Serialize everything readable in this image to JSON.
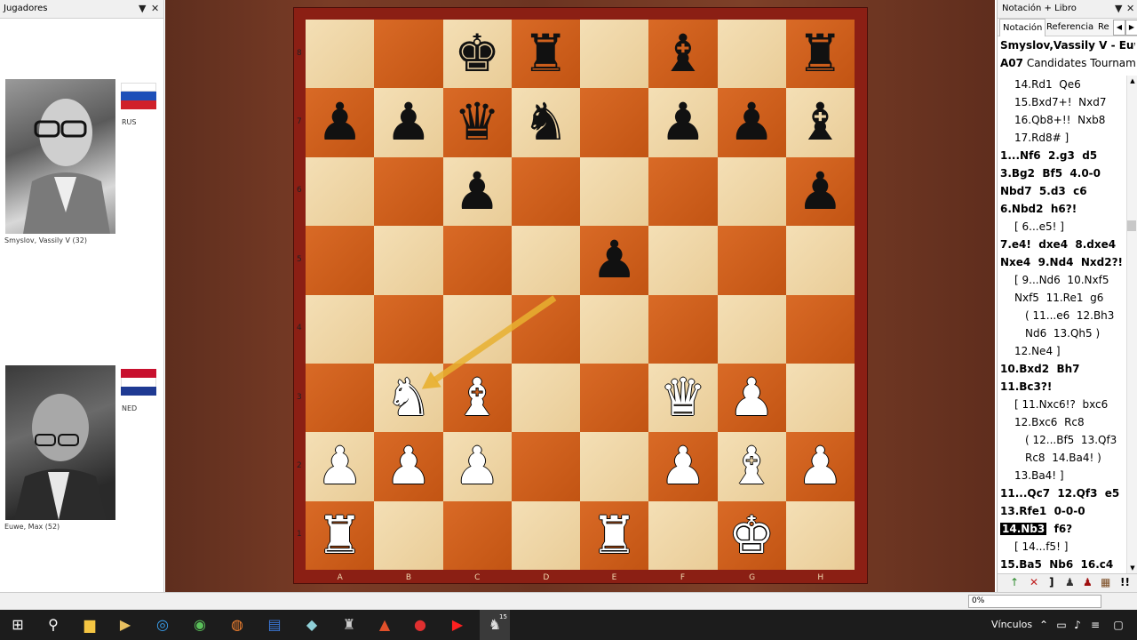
{
  "left_panel": {
    "title": "Jugadores",
    "players": [
      {
        "name": "Smyslov, Vassily V  (32)",
        "country": "RUS",
        "flag_colors": [
          "#ffffff",
          "#1d4fb8",
          "#d0202a"
        ]
      },
      {
        "name": "Euwe, Max  (52)",
        "country": "NED",
        "flag_colors": [
          "#c8102e",
          "#ffffff",
          "#1f3a93"
        ]
      }
    ]
  },
  "board": {
    "files": [
      "A",
      "B",
      "C",
      "D",
      "E",
      "F",
      "G",
      "H"
    ],
    "ranks": [
      "8",
      "7",
      "6",
      "5",
      "4",
      "3",
      "2",
      "1"
    ],
    "pieces": [
      {
        "sq": "c8",
        "glyph": "♚",
        "color": "black"
      },
      {
        "sq": "d8",
        "glyph": "♜",
        "color": "black"
      },
      {
        "sq": "f8",
        "glyph": "♝",
        "color": "black"
      },
      {
        "sq": "h8",
        "glyph": "♜",
        "color": "black"
      },
      {
        "sq": "a7",
        "glyph": "♟",
        "color": "black"
      },
      {
        "sq": "b7",
        "glyph": "♟",
        "color": "black"
      },
      {
        "sq": "c7",
        "glyph": "♛",
        "color": "black"
      },
      {
        "sq": "d7",
        "glyph": "♞",
        "color": "black"
      },
      {
        "sq": "f7",
        "glyph": "♟",
        "color": "black"
      },
      {
        "sq": "g7",
        "glyph": "♟",
        "color": "black"
      },
      {
        "sq": "h7",
        "glyph": "♝",
        "color": "black"
      },
      {
        "sq": "c6",
        "glyph": "♟",
        "color": "black"
      },
      {
        "sq": "h6",
        "glyph": "♟",
        "color": "black"
      },
      {
        "sq": "e5",
        "glyph": "♟",
        "color": "black"
      },
      {
        "sq": "b3",
        "glyph": "♞",
        "color": "white"
      },
      {
        "sq": "c3",
        "glyph": "♝",
        "color": "white"
      },
      {
        "sq": "f3",
        "glyph": "♛",
        "color": "white"
      },
      {
        "sq": "g3",
        "glyph": "♟",
        "color": "white"
      },
      {
        "sq": "a2",
        "glyph": "♟",
        "color": "white"
      },
      {
        "sq": "b2",
        "glyph": "♟",
        "color": "white"
      },
      {
        "sq": "c2",
        "glyph": "♟",
        "color": "white"
      },
      {
        "sq": "f2",
        "glyph": "♟",
        "color": "white"
      },
      {
        "sq": "g2",
        "glyph": "♝",
        "color": "white"
      },
      {
        "sq": "h2",
        "glyph": "♟",
        "color": "white"
      },
      {
        "sq": "a1",
        "glyph": "♜",
        "color": "white"
      },
      {
        "sq": "e1",
        "glyph": "♜",
        "color": "white"
      },
      {
        "sq": "g1",
        "glyph": "♚",
        "color": "white"
      }
    ],
    "arrow": {
      "from": "d4",
      "to": "b3",
      "color": "#e8b030"
    }
  },
  "right_panel": {
    "title": "Notación + Libro",
    "tabs": [
      "Notación",
      "Referencia",
      "Rep"
    ],
    "header_players": "Smyslov,Vassily V - Euwe,M",
    "header_eco": "A07",
    "header_event": "Candidates Tournament",
    "lines": [
      {
        "t": "14.Rd1  Qe6",
        "i": 1,
        "s": ""
      },
      {
        "t": "15.Bxd7+!  Nxd7",
        "i": 1,
        "s": ""
      },
      {
        "t": "16.Qb8+!!  Nxb8",
        "i": 1,
        "s": ""
      },
      {
        "t": "17.Rd8# ]",
        "i": 1,
        "s": ""
      },
      {
        "t": "1...Nf6  2.g3  d5",
        "i": 0,
        "s": "b"
      },
      {
        "t": "3.Bg2  Bf5  4.0-0",
        "i": 0,
        "s": "b"
      },
      {
        "t": "Nbd7  5.d3  c6",
        "i": 0,
        "s": "b"
      },
      {
        "t": "6.Nbd2  h6?!",
        "i": 0,
        "s": "b"
      },
      {
        "t": "[ 6...e5! ]",
        "i": 1,
        "s": ""
      },
      {
        "t": "7.e4!  dxe4  8.dxe4",
        "i": 0,
        "s": "b"
      },
      {
        "t": "Nxe4  9.Nd4  Nxd2?!",
        "i": 0,
        "s": "b"
      },
      {
        "t": "[ 9...Nd6  10.Nxf5",
        "i": 1,
        "s": ""
      },
      {
        "t": "Nxf5  11.Re1  g6",
        "i": 1,
        "s": ""
      },
      {
        "t": "( 11...e6  12.Bh3",
        "i": 2,
        "s": ""
      },
      {
        "t": "Nd6  13.Qh5 )",
        "i": 2,
        "s": ""
      },
      {
        "t": "12.Ne4 ]",
        "i": 1,
        "s": ""
      },
      {
        "t": "10.Bxd2  Bh7",
        "i": 0,
        "s": "b"
      },
      {
        "t": "11.Bc3?!",
        "i": 0,
        "s": "b"
      },
      {
        "t": "[ 11.Nxc6!?  bxc6",
        "i": 1,
        "s": ""
      },
      {
        "t": "12.Bxc6  Rc8",
        "i": 1,
        "s": ""
      },
      {
        "t": "( 12...Bf5  13.Qf3",
        "i": 2,
        "s": ""
      },
      {
        "t": "Rc8  14.Ba4! )",
        "i": 2,
        "s": ""
      },
      {
        "t": "13.Ba4! ]",
        "i": 1,
        "s": ""
      },
      {
        "t": "11...Qc7  12.Qf3  e5",
        "i": 0,
        "s": "b"
      },
      {
        "t": "13.Rfe1  0-0-0",
        "i": 0,
        "s": "b"
      },
      {
        "t": "14.Nb3  f6?",
        "i": 0,
        "s": "hl"
      },
      {
        "t": "[ 14...f5! ]",
        "i": 1,
        "s": ""
      },
      {
        "t": "15.Ba5  Nb6  16.c4",
        "i": 0,
        "s": "b"
      }
    ]
  },
  "status_bar": {
    "zoom": "0%"
  },
  "taskbar": {
    "tray_label": "Vínculos",
    "badge": "15"
  }
}
